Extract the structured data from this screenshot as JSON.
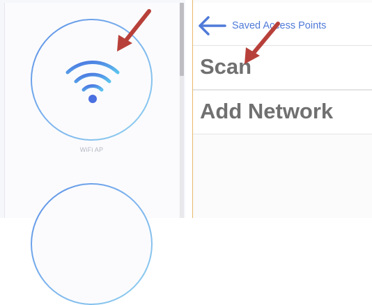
{
  "left_panel": {
    "ap_label": "WiFi AP",
    "icons": [
      "wifi-icon"
    ]
  },
  "right_panel": {
    "nav_title": "Saved Access Points",
    "menu": [
      {
        "label": "Scan"
      },
      {
        "label": "Add Network"
      }
    ]
  },
  "colors": {
    "accent_blue": "#4f7ad8",
    "annotation_arrow": "#b8403a",
    "menu_text": "#707070"
  }
}
